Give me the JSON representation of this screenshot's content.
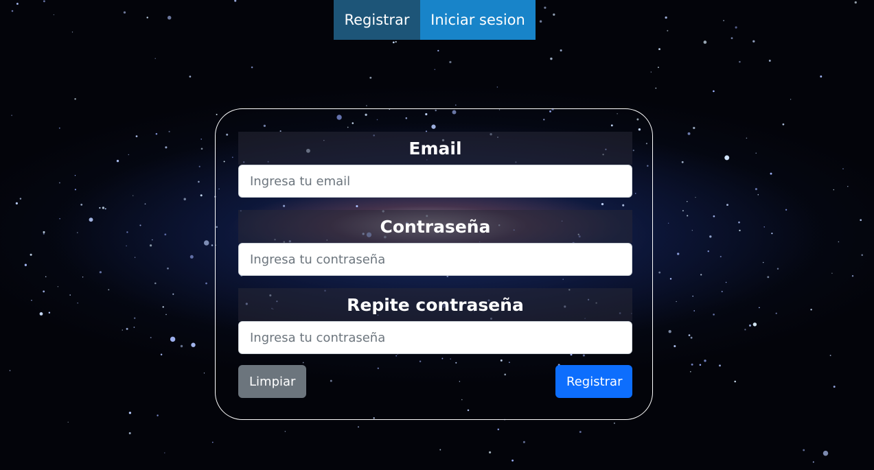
{
  "nav": {
    "register_label": "Registrar",
    "login_label": "Iniciar sesion"
  },
  "form": {
    "email_label": "Email",
    "email_placeholder": "Ingresa tu email",
    "email_value": "",
    "password_label": "Contraseña",
    "password_placeholder": "Ingresa tu contraseña",
    "password_value": "",
    "repeat_label": "Repite contraseña",
    "repeat_placeholder": "Ingresa tu contraseña",
    "repeat_value": "",
    "clear_label": "Limpiar",
    "submit_label": "Registrar"
  },
  "colors": {
    "nav_register_bg": "#1d5578",
    "nav_login_bg": "#1884c9",
    "clear_button": "#6c757d",
    "submit_button": "#0d6efd"
  }
}
